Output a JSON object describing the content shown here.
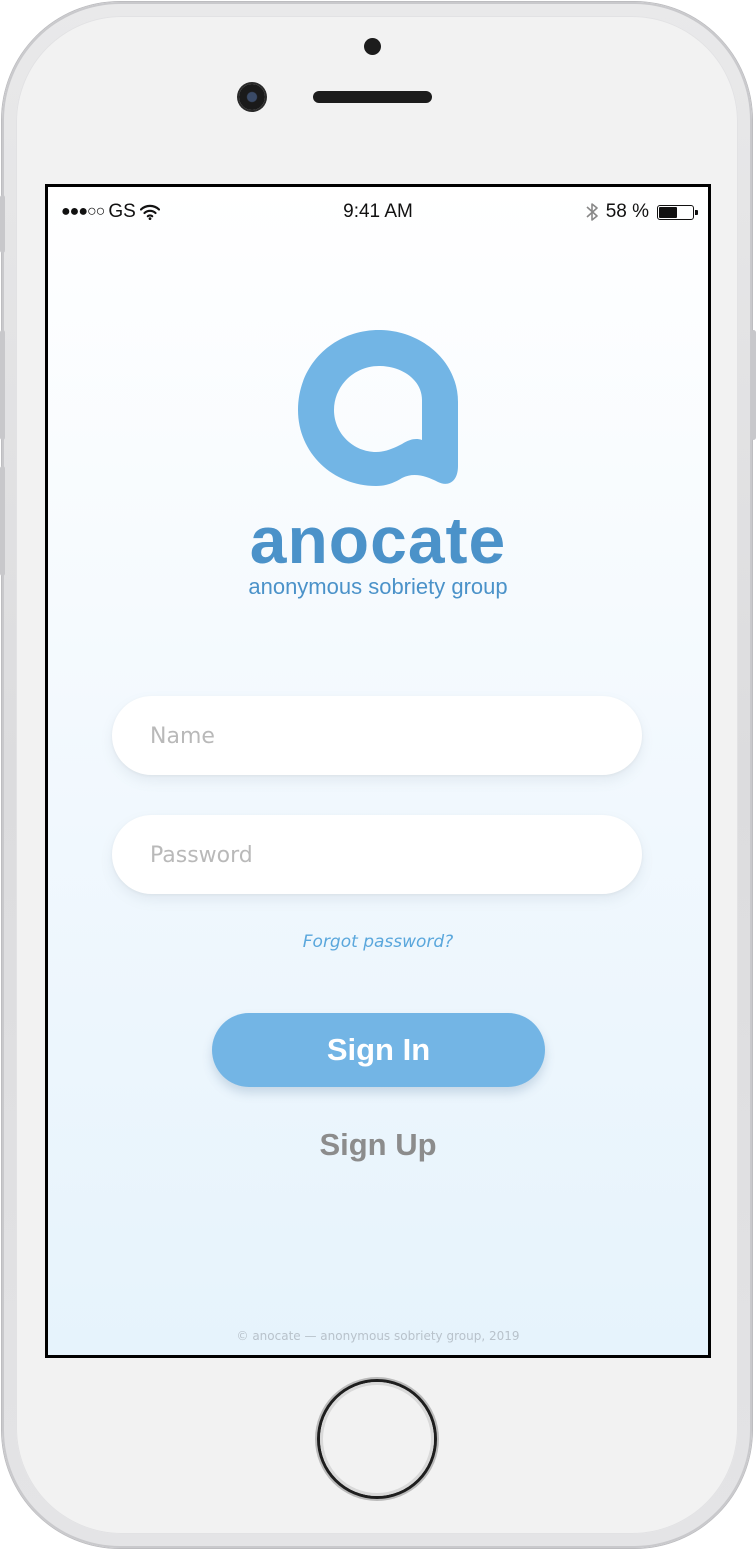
{
  "status_bar": {
    "signal": "●●●○○",
    "carrier": "GS",
    "time": "9:41 AM",
    "battery_text": "58 %",
    "battery_level": 0.58
  },
  "brand": {
    "name": "anocate",
    "tagline": "anonymous sobriety group",
    "color": "#4b92c9",
    "logo_color": "#72b5e5"
  },
  "form": {
    "name_placeholder": "Name",
    "password_placeholder": "Password",
    "forgot_label": "Forgot password?",
    "signin_label": "Sign In",
    "signup_label": "Sign Up"
  },
  "footer": {
    "text": "© anocate — anonymous sobriety group, 2019"
  },
  "colors": {
    "accent": "#73b5e5",
    "link": "#5aa7dc",
    "secondary_text": "#8c8c8c"
  }
}
